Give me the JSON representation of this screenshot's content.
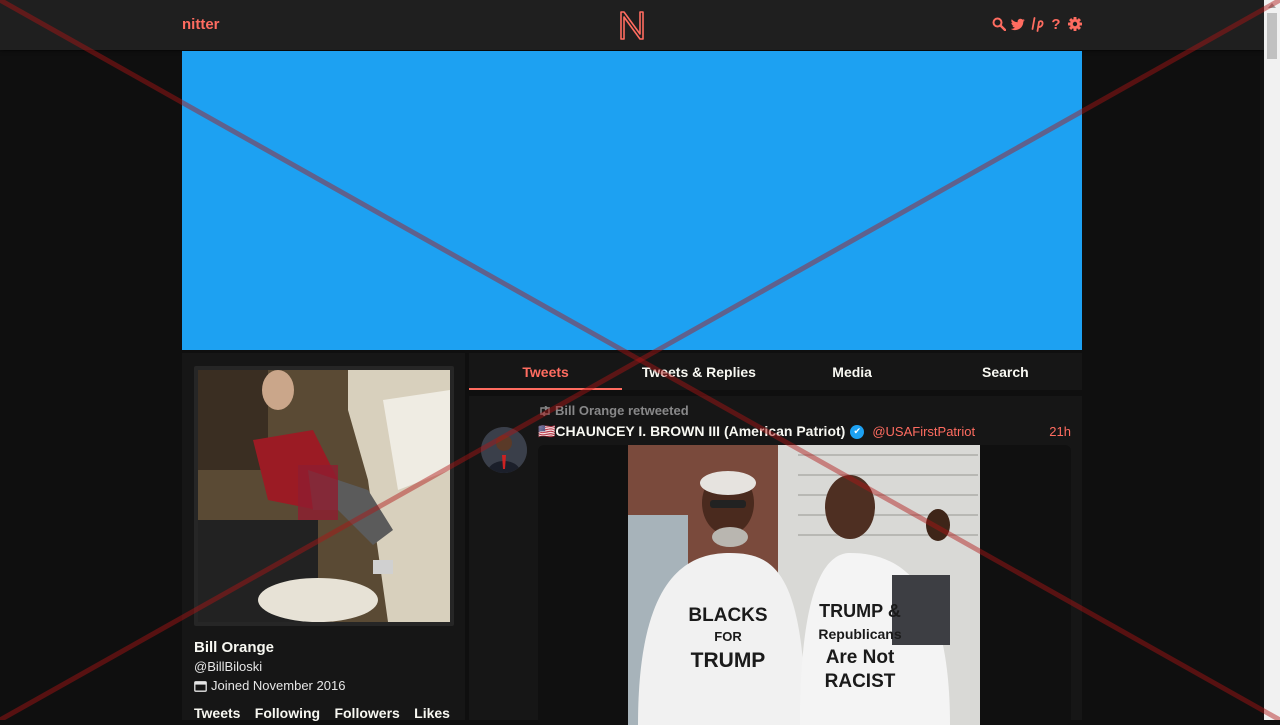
{
  "nav": {
    "brand": "nitter",
    "logo_letter": "N",
    "icons": [
      "search-icon",
      "twitter-bird-icon",
      "lp-icon",
      "help-icon",
      "settings-gear-icon"
    ],
    "help_glyph": "?"
  },
  "profile": {
    "fullname": "Bill Orange",
    "username": "@BillBiloski",
    "joined": "Joined November 2016",
    "stats": [
      "Tweets",
      "Following",
      "Followers",
      "Likes"
    ]
  },
  "tabs": [
    "Tweets",
    "Tweets & Replies",
    "Media",
    "Search"
  ],
  "tweet": {
    "retweet_text": "Bill Orange retweeted",
    "fullname": "🇺🇸CHAUNCEY I. BROWN III (American Patriot)",
    "username": "@USAFirstPatriot",
    "date": "21h",
    "shirt_left": [
      "BLACKS",
      "FOR",
      "TRUMP"
    ],
    "shirt_right": [
      "TRUMP &",
      "Republicans",
      "Are Not",
      "RACIST"
    ]
  },
  "colors": {
    "accent": "#ff6c60",
    "banner": "#1da1f2",
    "background": "#0f0f0f",
    "panel": "#161616",
    "navbar": "#1f1f1f"
  }
}
